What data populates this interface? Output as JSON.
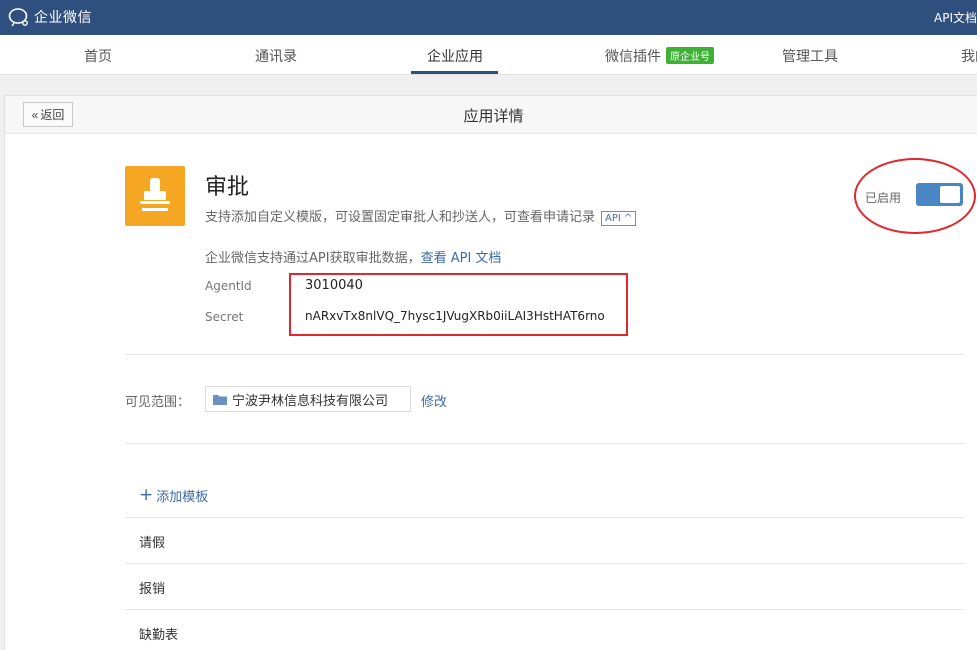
{
  "topbar": {
    "logo_text": "企业微信",
    "api_doc": "API文档"
  },
  "nav": {
    "items": [
      {
        "label": "首页"
      },
      {
        "label": "通讯录"
      },
      {
        "label": "企业应用"
      },
      {
        "label": "微信插件",
        "badge": "原企业号"
      },
      {
        "label": "管理工具"
      },
      {
        "label": "我的"
      }
    ],
    "active_index": 2
  },
  "panel": {
    "back_label": "返回",
    "title": "应用详情"
  },
  "app": {
    "name": "审批",
    "description": "支持添加自定义模版，可设置固定审批人和抄送人，可查看申请记录",
    "api_tag": "API",
    "api_note": "企业微信支持通过API获取审批数据，",
    "api_link": "查看 API 文档",
    "agentid_label": "AgentId",
    "agentid_value": "3010040",
    "secret_label": "Secret",
    "secret_value": "nARxvTx8nlVQ_7hysc1JVugXRb0iiLAI3HstHAT6rno",
    "status_label": "已启用",
    "enabled": true
  },
  "scope": {
    "label": "可见范围：",
    "value": "宁波尹林信息科技有限公司",
    "edit_label": "修改"
  },
  "templates": {
    "add_label": "添加模板",
    "items": [
      "请假",
      "报销",
      "缺勤表"
    ]
  },
  "colors": {
    "topbar": "#2f4f7f",
    "accent": "#4a86c6",
    "badge": "#3eb135",
    "highlight": "#e0282e",
    "icon_bg": "#f5a623"
  }
}
